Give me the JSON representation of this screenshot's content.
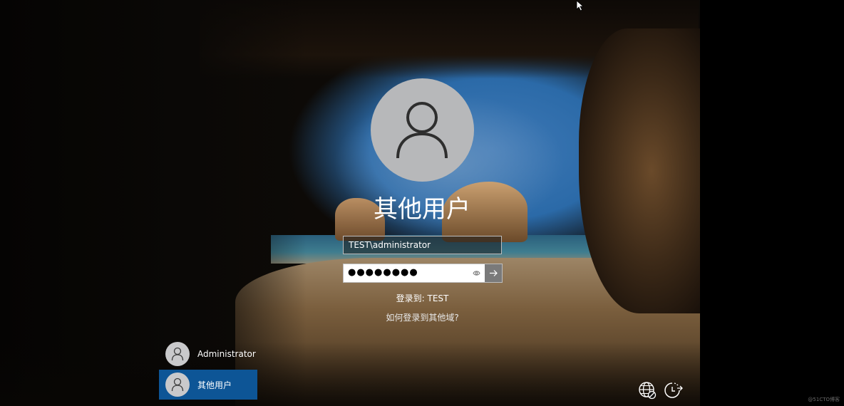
{
  "login": {
    "display_name": "其他用户",
    "username_value": "TEST\\administrator",
    "password_masked": "●●●●●●●●",
    "signin_to": "登录到: TEST",
    "other_domain_link": "如何登录到其他域?"
  },
  "user_list": [
    {
      "name": "Administrator",
      "selected": false
    },
    {
      "name": "其他用户",
      "selected": true
    }
  ],
  "icons": {
    "network": "network-icon",
    "power": "power-icon",
    "reveal": "eye-icon",
    "submit": "arrow-right-icon"
  },
  "colors": {
    "selected_user_bg": "#0d5596",
    "avatar_bg": "#b7b8ba",
    "submit_bg": "#7a7a7a"
  },
  "watermark": "@51CTO博客"
}
